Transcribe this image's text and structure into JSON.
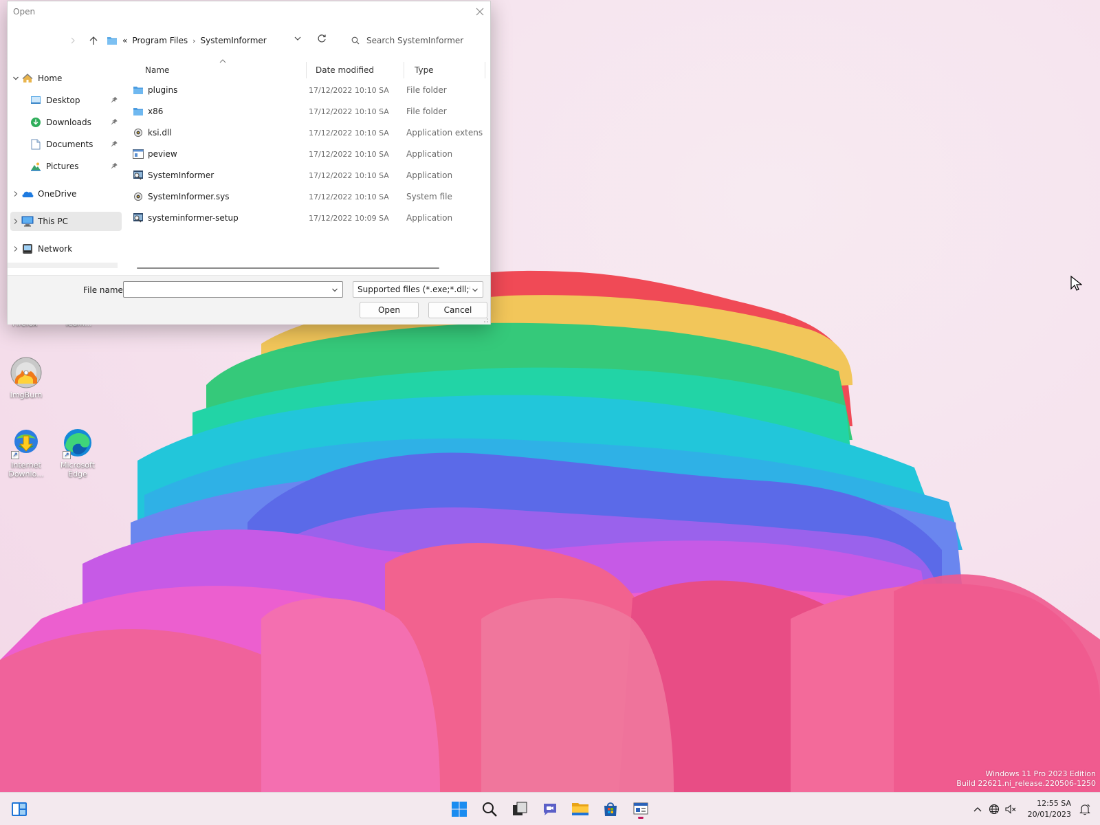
{
  "dialog": {
    "title": "Open",
    "address": {
      "overflow": "«",
      "crumbs": [
        "Program Files",
        "SystemInformer"
      ],
      "separator": "›"
    },
    "search_placeholder": "Search SystemInformer",
    "nav": [
      {
        "label": "Home",
        "icon": "home-icon",
        "expanded": true
      },
      {
        "label": "Desktop",
        "icon": "desktop-folder-icon",
        "pinned": true
      },
      {
        "label": "Downloads",
        "icon": "downloads-folder-icon",
        "pinned": true
      },
      {
        "label": "Documents",
        "icon": "documents-folder-icon",
        "pinned": true
      },
      {
        "label": "Pictures",
        "icon": "pictures-folder-icon",
        "pinned": true
      },
      {
        "label": "OneDrive",
        "icon": "onedrive-icon"
      },
      {
        "label": "This PC",
        "icon": "this-pc-icon",
        "selected": true
      },
      {
        "label": "Network",
        "icon": "network-icon"
      }
    ],
    "columns": {
      "name": "Name",
      "date": "Date modified",
      "type": "Type"
    },
    "files": [
      {
        "name": "plugins",
        "date": "17/12/2022 10:10 SA",
        "type": "File folder",
        "icon": "folder-icon"
      },
      {
        "name": "x86",
        "date": "17/12/2022 10:10 SA",
        "type": "File folder",
        "icon": "folder-icon"
      },
      {
        "name": "ksi.dll",
        "date": "17/12/2022 10:10 SA",
        "type": "Application extens...",
        "icon": "dll-gear-icon"
      },
      {
        "name": "peview",
        "date": "17/12/2022 10:10 SA",
        "type": "Application",
        "icon": "app-window-icon"
      },
      {
        "name": "SystemInformer",
        "date": "17/12/2022 10:10 SA",
        "type": "Application",
        "icon": "system-informer-icon"
      },
      {
        "name": "SystemInformer.sys",
        "date": "17/12/2022 10:10 SA",
        "type": "System file",
        "icon": "sys-gear-icon"
      },
      {
        "name": "systeminformer-setup",
        "date": "17/12/2022 10:09 SA",
        "type": "Application",
        "icon": "system-informer-icon"
      }
    ],
    "file_name_label": "File name:",
    "file_name_value": "",
    "filter_value": "Supported files (*.exe;*.dll;*.com",
    "open_label": "Open",
    "cancel_label": "Cancel"
  },
  "desktop": {
    "icons": [
      {
        "label": "ImgBurn",
        "icon": "imgburn-icon"
      },
      {
        "label": "Internet Downlo...",
        "icon": "internet-download-manager-icon"
      },
      {
        "label": "Microsoft Edge",
        "icon": "edge-icon"
      }
    ],
    "cut_labels": [
      "Firefox",
      "Team..."
    ],
    "watermark": {
      "line1": "Windows 11 Pro 2023 Edition",
      "line2": "Build 22621.ni_release.220506-1250"
    }
  },
  "taskbar": {
    "items": [
      "widgets-icon",
      "start-icon",
      "search-icon",
      "task-view-icon",
      "chat-icon",
      "file-explorer-icon",
      "store-icon",
      "system-informer-icon"
    ],
    "tray": [
      "chevron-up-icon",
      "network-globe-icon",
      "volume-muted-icon",
      "notification-icon"
    ],
    "clock": {
      "time": "12:55 SA",
      "date": "20/01/2023"
    }
  },
  "colors": {
    "folder": "#5aa9e6",
    "accent": "#1d6fd1",
    "selection": "#e8e8e8",
    "wallpaper_pink": "#f2628f"
  }
}
